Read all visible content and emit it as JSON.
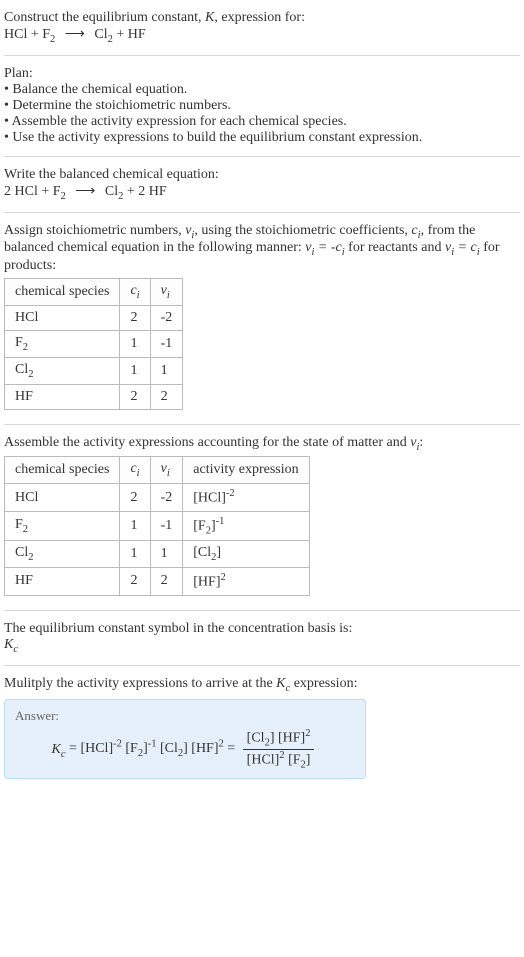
{
  "prompt": {
    "line1_a": "Construct the equilibrium constant, ",
    "line1_b": ", expression for:",
    "eq_lhs1": "HCl + F",
    "eq_rhs1a": "Cl",
    "eq_rhs1b": " + HF"
  },
  "plan": {
    "heading": "Plan:",
    "b1": "• Balance the chemical equation.",
    "b2": "• Determine the stoichiometric numbers.",
    "b3": "• Assemble the activity expression for each chemical species.",
    "b4": "• Use the activity expressions to build the equilibrium constant expression."
  },
  "balanced": {
    "heading": "Write the balanced chemical equation:",
    "lhs_a": "2 HCl + F",
    "rhs_a": "Cl",
    "rhs_b": " + 2 HF"
  },
  "assign": {
    "text_a": "Assign stoichiometric numbers, ",
    "text_b": ", using the stoichiometric coefficients, ",
    "text_c": ", from the balanced chemical equation in the following manner: ",
    "text_d": " for reactants and ",
    "text_e": " for products:"
  },
  "table1": {
    "h1": "chemical species",
    "rows": [
      {
        "sp": "HCl",
        "c": "2",
        "v": "-2"
      },
      {
        "sp": "F",
        "c": "1",
        "v": "-1"
      },
      {
        "sp": "Cl",
        "c": "1",
        "v": "1"
      },
      {
        "sp": "HF",
        "c": "2",
        "v": "2"
      }
    ]
  },
  "assemble": {
    "text_a": "Assemble the activity expressions accounting for the state of matter and "
  },
  "table2": {
    "h1": "chemical species",
    "h4": "activity expression",
    "rows": [
      {
        "sp": "HCl",
        "c": "2",
        "v": "-2",
        "act_base": "[HCl]",
        "act_exp": "-2"
      },
      {
        "sp": "F",
        "c": "1",
        "v": "-1",
        "act_base": "[F",
        "act_exp": "-1"
      },
      {
        "sp": "Cl",
        "c": "1",
        "v": "1",
        "act_base": "[Cl",
        "act_exp": ""
      },
      {
        "sp": "HF",
        "c": "2",
        "v": "2",
        "act_base": "[HF]",
        "act_exp": "2"
      }
    ]
  },
  "symbol_line": "The equilibrium constant symbol in the concentration basis is:",
  "multiply_line_a": "Mulitply the activity expressions to arrive at the ",
  "multiply_line_b": " expression:",
  "answer_label": "Answer:"
}
